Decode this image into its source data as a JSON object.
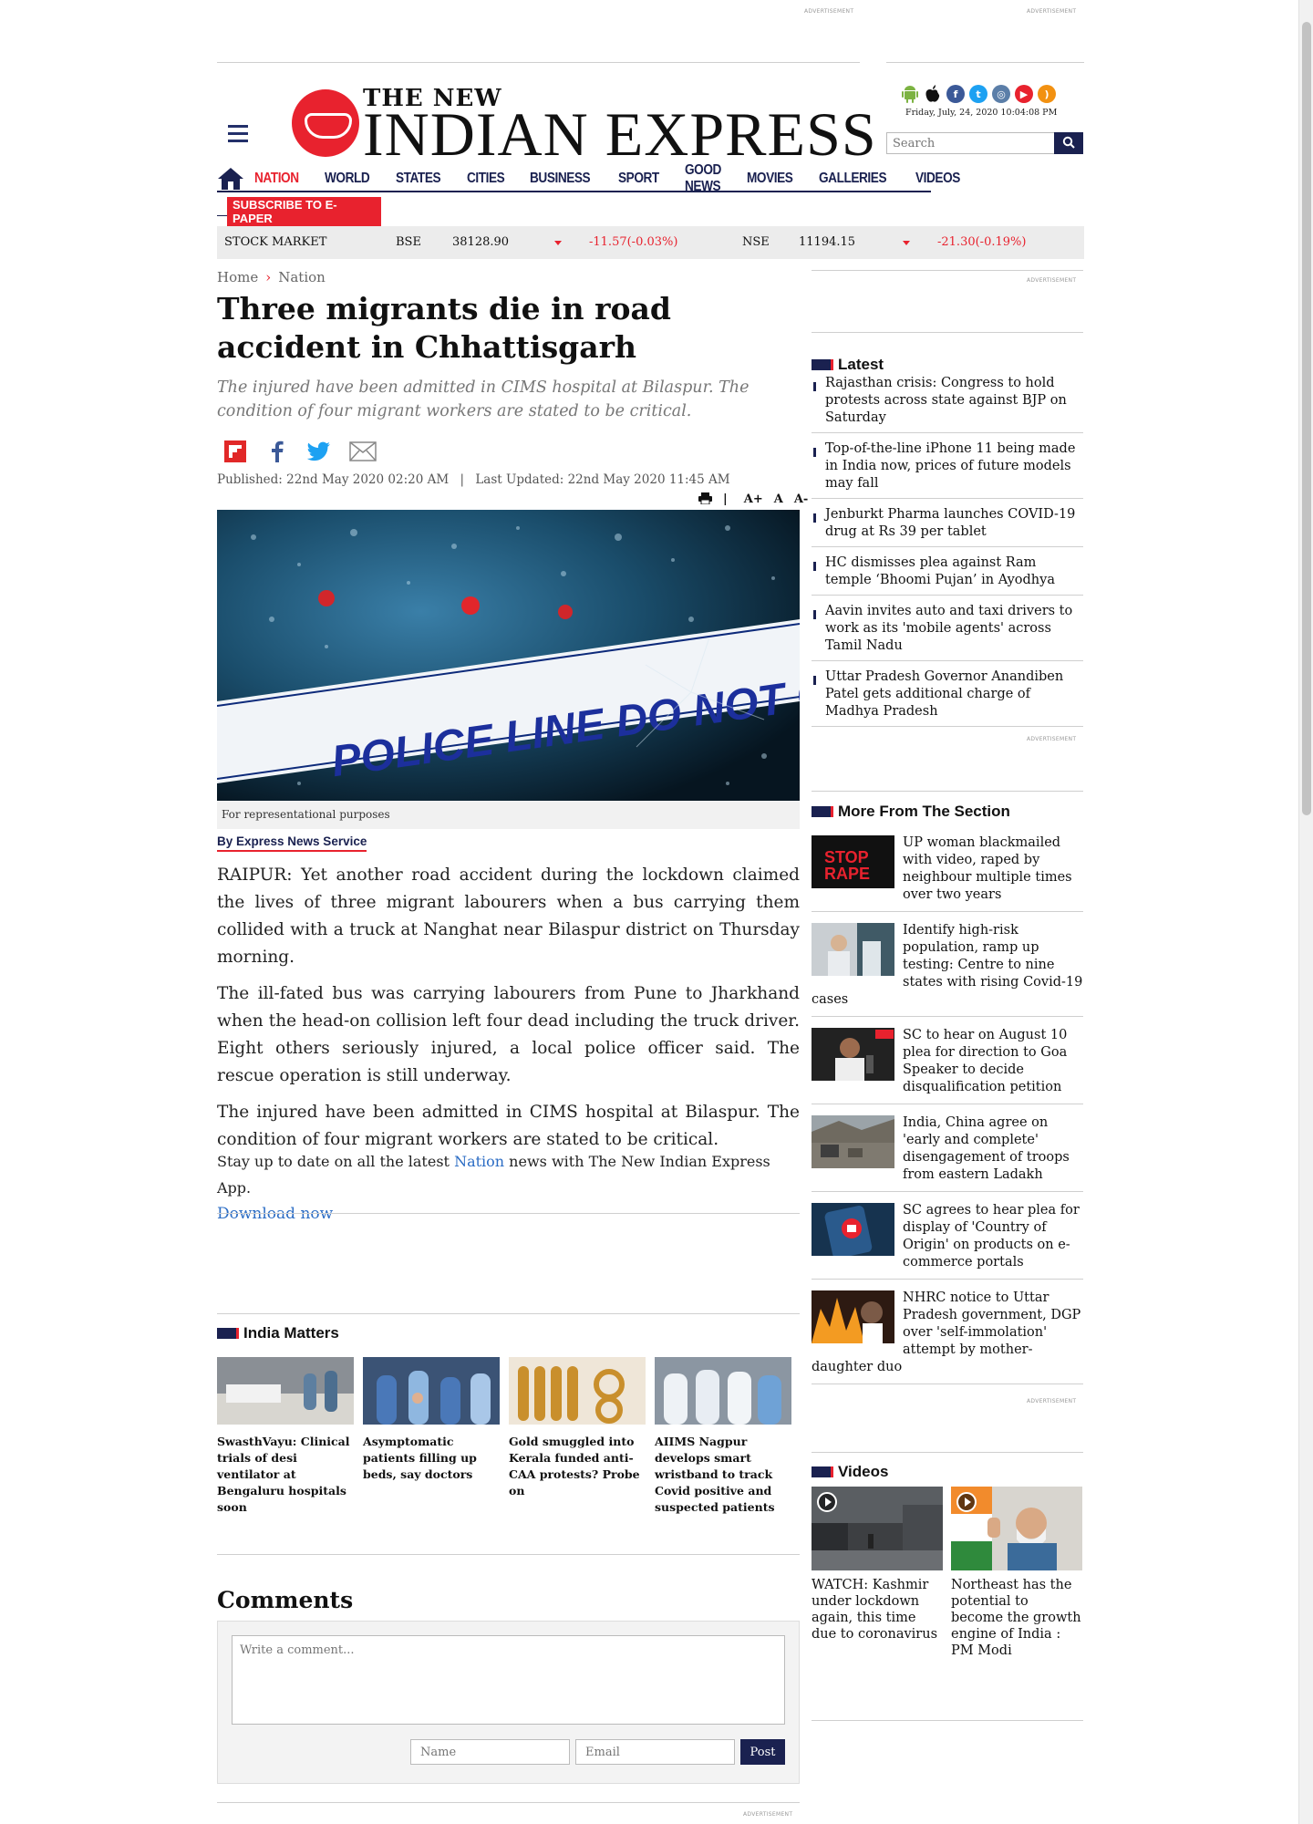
{
  "ads": {
    "label": "Advertisement"
  },
  "header": {
    "logo_top": "THE NEW",
    "logo_main": "INDIAN EXPRESS",
    "datetime": "Friday, July, 24, 2020  10:04:08 PM",
    "search_placeholder": "Search",
    "app_icons": [
      "android-icon",
      "apple-icon",
      "facebook-icon",
      "twitter-icon",
      "instagram-icon",
      "youtube-icon",
      "rss-icon"
    ]
  },
  "nav": {
    "items": [
      "NATION",
      "WORLD",
      "STATES",
      "CITIES",
      "BUSINESS",
      "SPORT",
      "GOOD NEWS",
      "MOVIES",
      "GALLERIES",
      "VIDEOS"
    ],
    "subscribe": "SUBSCRIBE TO E-PAPER"
  },
  "stock": {
    "label": "STOCK MARKET",
    "bse_label": "BSE",
    "bse_value": "38128.90",
    "bse_change": "-11.57(-0.03%)",
    "nse_label": "NSE",
    "nse_value": "11194.15",
    "nse_change": "-21.30(-0.19%)"
  },
  "article": {
    "breadcrumb": [
      "Home",
      "Nation"
    ],
    "title": "Three migrants die in road accident in Chhattisgarh",
    "summary": "The injured have been admitted in CIMS hospital at Bilaspur. The condition of four migrant workers are stated to be critical.",
    "published": "Published: 22nd May 2020 02:20 AM",
    "updated": "Last Updated: 22nd May 2020 11:45 AM",
    "font_tools": [
      "A+",
      "A",
      "A-"
    ],
    "image_text": "POLICE LINE DO NOT CROSS",
    "caption": "For representational purposes",
    "byline": "By Express News Service",
    "paragraphs": [
      "RAIPUR: Yet another road accident during the lockdown claimed the lives of three migrant labourers when a bus carrying them collided with a truck at Nanghat near Bilaspur district on Thursday morning.",
      "The ill-fated bus was carrying labourers from Pune to Jharkhand when the head-on collision left four dead including the truck driver. Eight others seriously injured, a local police officer said. The rescue operation is still underway.",
      "The injured have been admitted in CIMS hospital at Bilaspur. The condition of four migrant workers are stated to be critical."
    ],
    "promo_before": "Stay up to date on all the latest ",
    "promo_link": "Nation",
    "promo_after": " news with The New Indian Express App.",
    "download": "Download now"
  },
  "india_matters": {
    "heading": "India Matters",
    "items": [
      "SwasthVayu: Clinical trials of desi ventilator at Bengaluru hospitals soon",
      "Asymptomatic patients filling up beds, say doctors",
      "Gold smuggled into Kerala funded anti-CAA protests? Probe on",
      "AIIMS Nagpur develops smart wristband to track Covid positive and suspected patients"
    ]
  },
  "comments": {
    "title": "Comments",
    "placeholder": "Write a comment...",
    "name_placeholder": "Name",
    "email_placeholder": "Email",
    "post": "Post"
  },
  "sidebar": {
    "latest_heading": "Latest",
    "latest": [
      "Rajasthan crisis: Congress to hold protests across state against BJP on Saturday",
      "Top-of-the-line iPhone 11 being made in India now, prices of future models may fall",
      "Jenburkt Pharma launches COVID-19 drug at Rs 39 per tablet",
      "HC dismisses plea against Ram temple ‘Bhoomi Pujan’ in Ayodhya",
      "Aavin invites auto and taxi drivers to work as its 'mobile agents' across Tamil Nadu",
      "Uttar Pradesh Governor Anandiben Patel gets additional charge of Madhya Pradesh"
    ],
    "more_heading": "More From The Section",
    "more": [
      "UP woman blackmailed with video, raped by neighbour multiple times over two years",
      "Identify high-risk population, ramp up testing: Centre to nine states with rising Covid-19 cases",
      "SC to hear on August 10 plea for direction to Goa Speaker to decide disqualification petition",
      "India, China agree on 'early and complete' disengagement of troops from eastern Ladakh",
      "SC agrees to hear plea for display of 'Country of Origin' on products on e-commerce portals",
      "NHRC notice to Uttar Pradesh government, DGP over 'self-immolation' attempt by mother-daughter duo"
    ],
    "stop_rape_text": [
      "STOP",
      "RAPE"
    ],
    "videos_heading": "Videos",
    "videos": [
      "WATCH: Kashmir under lockdown again, this time due to coronavirus",
      "Northeast has the potential to become the growth engine of India : PM Modi"
    ]
  }
}
